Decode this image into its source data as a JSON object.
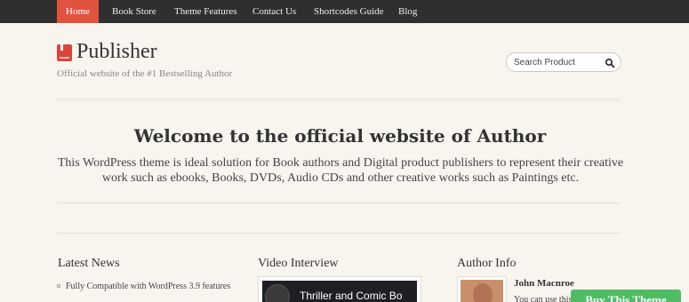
{
  "nav": {
    "items": [
      {
        "label": "Home",
        "active": true
      },
      {
        "label": "Book Store"
      },
      {
        "label": "Theme Features"
      },
      {
        "label": "Contact Us"
      },
      {
        "label": "Shortcodes Guide"
      },
      {
        "label": "Blog"
      }
    ]
  },
  "header": {
    "logo_icon": "book-icon",
    "title": "Publisher",
    "tagline": "Official website of the #1 Bestselling Author"
  },
  "search": {
    "placeholder": "Search Product",
    "icon": "search-icon"
  },
  "welcome": {
    "title": "Welcome to the official website of Author",
    "text": "This WordPress theme is ideal solution for Book authors and Digital product publishers to represent their creative work such as ebooks, Books, DVDs, Audio CDs and other creative works such as Paintings etc."
  },
  "latest_news": {
    "title": "Latest News",
    "items": [
      "Fully Compatible with WordPress 3.9 features"
    ]
  },
  "video": {
    "title": "Video Interview",
    "video_title": "Thriller and Comic Bo"
  },
  "author": {
    "title": "Author Info",
    "name": "John Macnroe",
    "text": "You can use this"
  },
  "buy": {
    "label": "Buy This Theme"
  },
  "colors": {
    "nav_bg": "#2f2f2f",
    "nav_active": "#e0533f",
    "page_bg": "#f8f5ee",
    "buy_green": "#4ebc63",
    "logo_red": "#d9453d"
  }
}
